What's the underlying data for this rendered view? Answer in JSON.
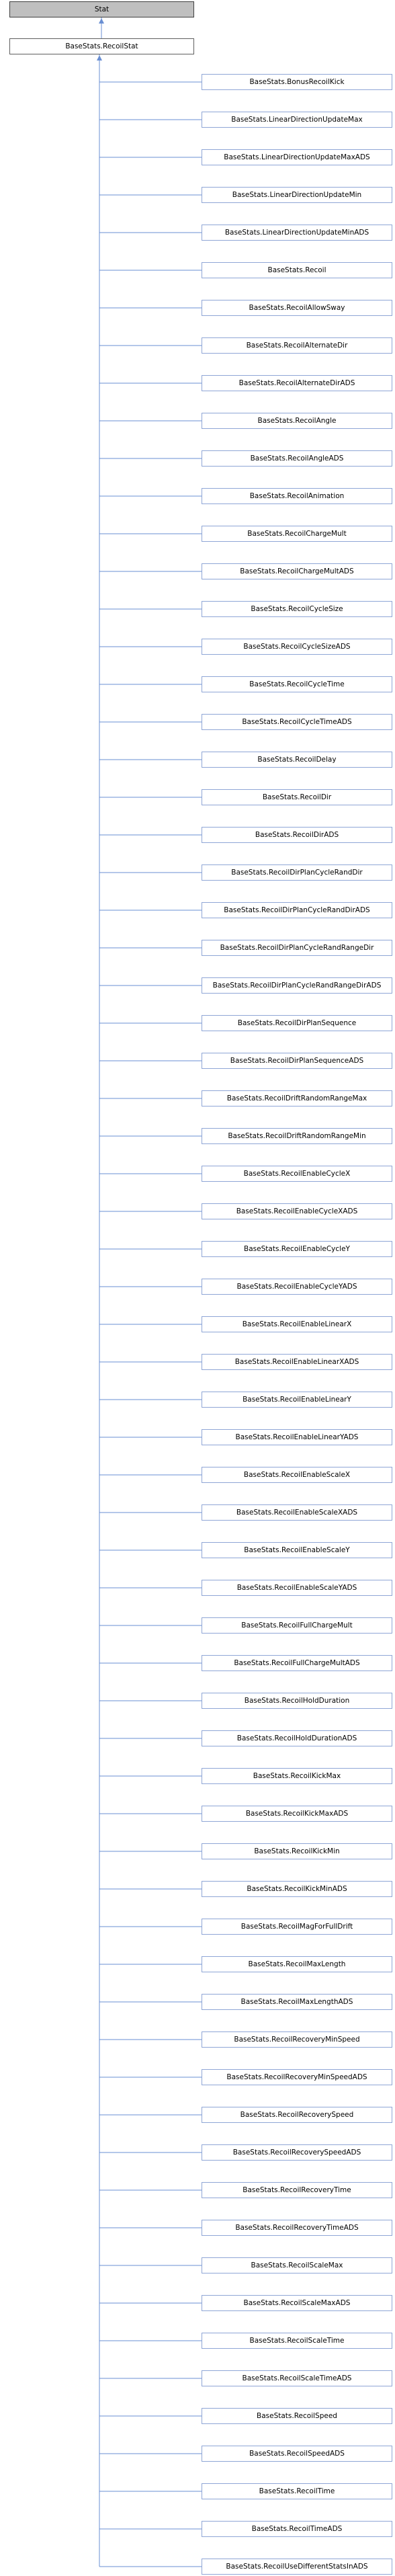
{
  "root": {
    "label": "Stat"
  },
  "main": {
    "label": "BaseStats.RecoilStat"
  },
  "children": [
    "BaseStats.BonusRecoilKick",
    "BaseStats.LinearDirectionUpdateMax",
    "BaseStats.LinearDirectionUpdateMaxADS",
    "BaseStats.LinearDirectionUpdateMin",
    "BaseStats.LinearDirectionUpdateMinADS",
    "BaseStats.Recoil",
    "BaseStats.RecoilAllowSway",
    "BaseStats.RecoilAlternateDir",
    "BaseStats.RecoilAlternateDirADS",
    "BaseStats.RecoilAngle",
    "BaseStats.RecoilAngleADS",
    "BaseStats.RecoilAnimation",
    "BaseStats.RecoilChargeMult",
    "BaseStats.RecoilChargeMultADS",
    "BaseStats.RecoilCycleSize",
    "BaseStats.RecoilCycleSizeADS",
    "BaseStats.RecoilCycleTime",
    "BaseStats.RecoilCycleTimeADS",
    "BaseStats.RecoilDelay",
    "BaseStats.RecoilDir",
    "BaseStats.RecoilDirADS",
    "BaseStats.RecoilDirPlanCycleRandDir",
    "BaseStats.RecoilDirPlanCycleRandDirADS",
    "BaseStats.RecoilDirPlanCycleRandRangeDir",
    "BaseStats.RecoilDirPlanCycleRandRangeDirADS",
    "BaseStats.RecoilDirPlanSequence",
    "BaseStats.RecoilDirPlanSequenceADS",
    "BaseStats.RecoilDriftRandomRangeMax",
    "BaseStats.RecoilDriftRandomRangeMin",
    "BaseStats.RecoilEnableCycleX",
    "BaseStats.RecoilEnableCycleXADS",
    "BaseStats.RecoilEnableCycleY",
    "BaseStats.RecoilEnableCycleYADS",
    "BaseStats.RecoilEnableLinearX",
    "BaseStats.RecoilEnableLinearXADS",
    "BaseStats.RecoilEnableLinearY",
    "BaseStats.RecoilEnableLinearYADS",
    "BaseStats.RecoilEnableScaleX",
    "BaseStats.RecoilEnableScaleXADS",
    "BaseStats.RecoilEnableScaleY",
    "BaseStats.RecoilEnableScaleYADS",
    "BaseStats.RecoilFullChargeMult",
    "BaseStats.RecoilFullChargeMultADS",
    "BaseStats.RecoilHoldDuration",
    "BaseStats.RecoilHoldDurationADS",
    "BaseStats.RecoilKickMax",
    "BaseStats.RecoilKickMaxADS",
    "BaseStats.RecoilKickMin",
    "BaseStats.RecoilKickMinADS",
    "BaseStats.RecoilMagForFullDrift",
    "BaseStats.RecoilMaxLength",
    "BaseStats.RecoilMaxLengthADS",
    "BaseStats.RecoilRecoveryMinSpeed",
    "BaseStats.RecoilRecoveryMinSpeedADS",
    "BaseStats.RecoilRecoverySpeed",
    "BaseStats.RecoilRecoverySpeedADS",
    "BaseStats.RecoilRecoveryTime",
    "BaseStats.RecoilRecoveryTimeADS",
    "BaseStats.RecoilScaleMax",
    "BaseStats.RecoilScaleMaxADS",
    "BaseStats.RecoilScaleTime",
    "BaseStats.RecoilScaleTimeADS",
    "BaseStats.RecoilSpeed",
    "BaseStats.RecoilSpeedADS",
    "BaseStats.RecoilTime",
    "BaseStats.RecoilTimeADS",
    "BaseStats.RecoilUseDifferentStatsInADS"
  ],
  "colors": {
    "edge": "#6a8fd3",
    "root_fill": "#bfbfbf",
    "node_border": "#5f5f5f"
  }
}
